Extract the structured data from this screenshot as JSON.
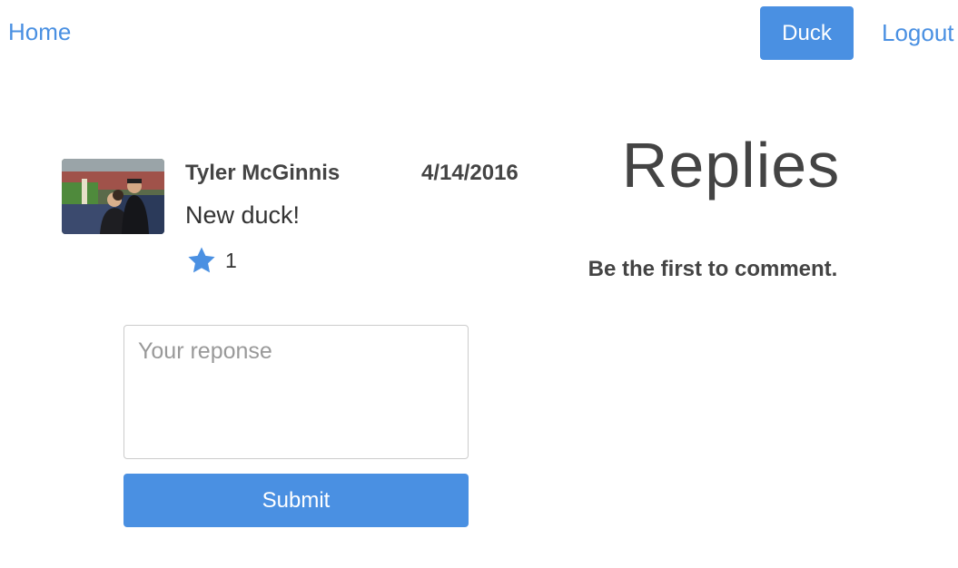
{
  "nav": {
    "home_label": "Home",
    "duck_label": "Duck",
    "logout_label": "Logout"
  },
  "duck": {
    "author": "Tyler McGinnis",
    "timestamp": "4/14/2016",
    "text": "New duck!",
    "like_count": "1",
    "avatar_icon": "user-photo-avatar"
  },
  "response_form": {
    "placeholder": "Your reponse",
    "value": "",
    "submit_label": "Submit"
  },
  "replies": {
    "title": "Replies",
    "empty_message": "Be the first to comment."
  },
  "colors": {
    "accent": "#4a90e2",
    "text": "#333333",
    "star": "#4a90e2"
  },
  "icons": {
    "like": "star-icon"
  }
}
